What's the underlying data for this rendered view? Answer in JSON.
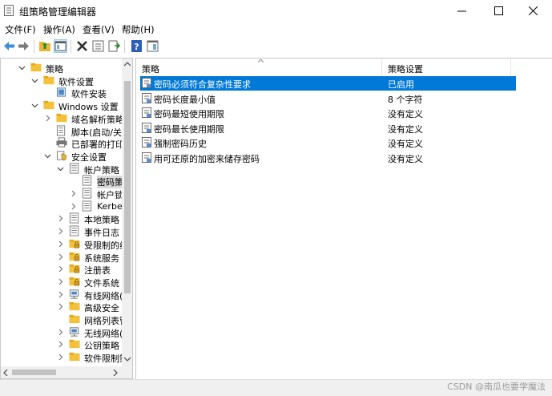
{
  "window": {
    "title": "组策略管理编辑器"
  },
  "menu": [
    "文件(F)",
    "操作(A)",
    "查看(V)",
    "帮助(H)"
  ],
  "tree": [
    {
      "label": "策略",
      "expander": "open",
      "icon": "folder-icon",
      "selected": false
    },
    {
      "label": "软件设置",
      "expander": "open",
      "icon": "folder-icon",
      "selected": false
    },
    {
      "label": "软件安装",
      "expander": "none",
      "icon": "software-install-icon",
      "selected": false
    },
    {
      "label": "Windows 设置",
      "expander": "open",
      "icon": "folder-icon",
      "selected": false
    },
    {
      "label": "域名解析策略",
      "expander": "closed",
      "icon": "folder-icon",
      "selected": false
    },
    {
      "label": "脚本(启动/关机",
      "expander": "none",
      "icon": "script-icon",
      "selected": false
    },
    {
      "label": "已部署的打印",
      "expander": "none",
      "icon": "printer-icon",
      "selected": false
    },
    {
      "label": "安全设置",
      "expander": "open",
      "icon": "security-icon",
      "selected": false
    },
    {
      "label": "帐户策略",
      "expander": "open",
      "icon": "policy-icon",
      "selected": false
    },
    {
      "label": "密码策",
      "expander": "none",
      "icon": "policy-icon",
      "selected": true
    },
    {
      "label": "帐户锁",
      "expander": "closed",
      "icon": "policy-icon",
      "selected": false
    },
    {
      "label": "Kerber",
      "expander": "closed",
      "icon": "policy-icon",
      "selected": false
    },
    {
      "label": "本地策略",
      "expander": "closed",
      "icon": "policy-icon",
      "selected": false
    },
    {
      "label": "事件日志",
      "expander": "closed",
      "icon": "policy-icon",
      "selected": false
    },
    {
      "label": "受限制的组",
      "expander": "closed",
      "icon": "folder-lock-icon",
      "selected": false
    },
    {
      "label": "系统服务",
      "expander": "closed",
      "icon": "folder-lock-icon",
      "selected": false
    },
    {
      "label": "注册表",
      "expander": "closed",
      "icon": "folder-lock-icon",
      "selected": false
    },
    {
      "label": "文件系统",
      "expander": "closed",
      "icon": "folder-lock-icon",
      "selected": false
    },
    {
      "label": "有线网络(I",
      "expander": "closed",
      "icon": "network-icon",
      "selected": false
    },
    {
      "label": "高级安全 V",
      "expander": "closed",
      "icon": "folder-icon",
      "selected": false
    },
    {
      "label": "网络列表管",
      "expander": "none",
      "icon": "folder-icon",
      "selected": false
    },
    {
      "label": "无线网络(I",
      "expander": "closed",
      "icon": "network-icon",
      "selected": false
    },
    {
      "label": "公钥策略",
      "expander": "closed",
      "icon": "folder-icon",
      "selected": false
    },
    {
      "label": "软件限制策",
      "expander": "closed",
      "icon": "folder-icon",
      "selected": false
    }
  ],
  "list": {
    "columns": [
      "策略",
      "策略设置"
    ],
    "rows": [
      {
        "name": "密码必须符合复杂性要求",
        "value": "已启用",
        "selected": true
      },
      {
        "name": "密码长度最小值",
        "value": "8 个字符",
        "selected": false
      },
      {
        "name": "密码最短使用期限",
        "value": "没有定义",
        "selected": false
      },
      {
        "name": "密码最长使用期限",
        "value": "没有定义",
        "selected": false
      },
      {
        "name": "强制密码历史",
        "value": "没有定义",
        "selected": false
      },
      {
        "name": "用可还原的加密来储存密码",
        "value": "没有定义",
        "selected": false
      }
    ]
  },
  "watermark": "CSDN @南瓜也要学魔法",
  "colors": {
    "selection": "#0078d7",
    "folder": "#f3c13a"
  }
}
